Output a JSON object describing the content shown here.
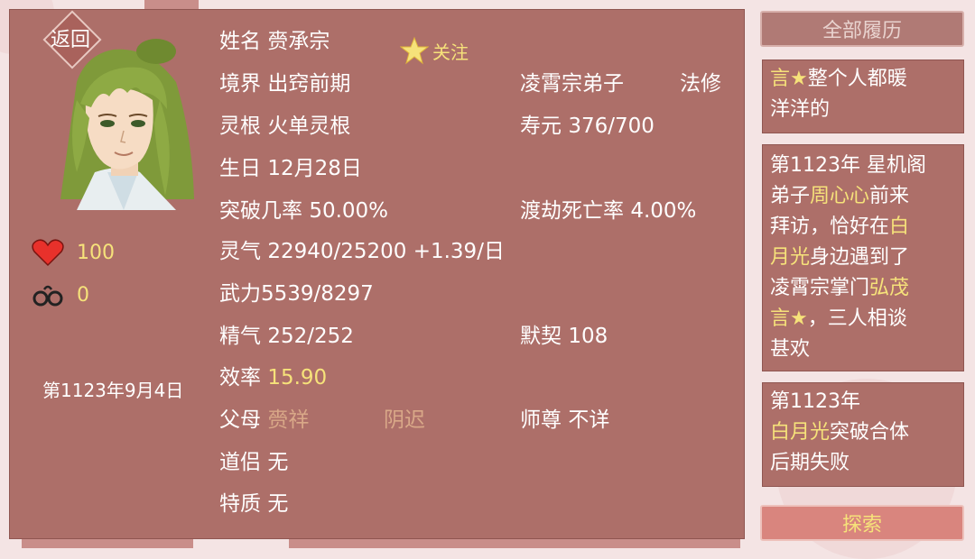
{
  "back_label": "返回",
  "follow_label": "关注",
  "stats": {
    "health": "100",
    "fetters": "0"
  },
  "date": "第1123年9月4日",
  "fields": {
    "name_label": "姓名",
    "name_value": "赍承宗",
    "realm_label": "境界",
    "realm_value": "出窍前期",
    "sect": "凌霄宗弟子",
    "class": "法修",
    "root_label": "灵根",
    "root_value": "火单灵根",
    "lifespan_label": "寿元",
    "lifespan_value": "376/700",
    "birthday_label": "生日",
    "birthday_value": "12月28日",
    "breakthrough_label": "突破几率",
    "breakthrough_value": "50.00%",
    "tribulation_label": "渡劫死亡率",
    "tribulation_value": "4.00%",
    "qi_label": "灵气",
    "qi_value": "22940/25200 +1.39/日",
    "force_label": "武力",
    "force_value": "5539/8297",
    "essence_label": "精气",
    "essence_value": "252/252",
    "rapport_label": "默契",
    "rapport_value": "108",
    "efficiency_label": "效率",
    "efficiency_value": "15.90",
    "parents_label": "父母",
    "father": "赍祥",
    "mother": "阴迟",
    "master_label": "师尊",
    "master_value": "不详",
    "partner_label": "道侣",
    "partner_value": "无",
    "trait_label": "特质",
    "trait_value": "无"
  },
  "history": {
    "all_label": "全部履历",
    "explore_label": "探索",
    "card1": {
      "l1_a": "言★",
      "l1_b": "整个人都暖",
      "l2": "洋洋的"
    },
    "card2": {
      "l1": "第1123年 星机阁",
      "l2_a": "弟子",
      "l2_b": "周心心",
      "l2_c": "前来",
      "l3": "拜访，恰好在",
      "l3_b": "白",
      "l4_a": "月光",
      "l4_b": "身边遇到了",
      "l5_a": "凌霄宗掌门",
      "l5_b": "弘茂",
      "l6_a": "言★",
      "l6_b": "，三人相谈",
      "l7": "甚欢"
    },
    "card3": {
      "l1": "第1123年",
      "l2_a": "白月光",
      "l2_b": "突破合体",
      "l3": "后期失败"
    }
  },
  "colors": {
    "panel": "#ad6f69",
    "highlight": "#f6e27a",
    "parent_name": "#d9a888"
  },
  "icons": {
    "health": "heart-icon",
    "fetters": "handcuffs-icon",
    "follow": "star-icon"
  }
}
